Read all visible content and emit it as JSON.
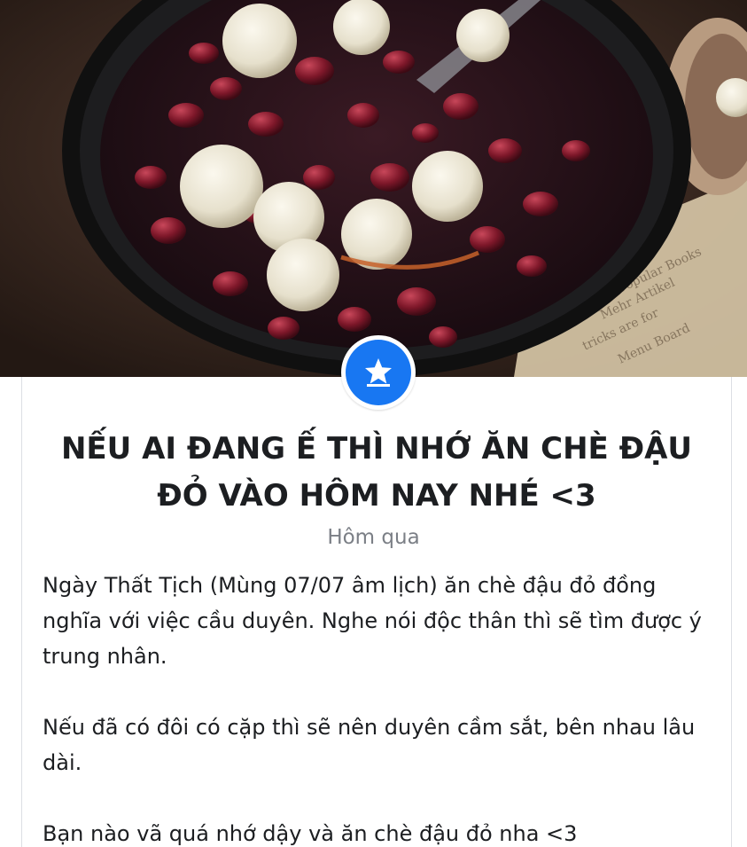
{
  "event": {
    "icon": "star-calendar-icon",
    "title": "NẾU AI ĐANG Ế THÌ NHỚ ĂN CHÈ ĐẬU ĐỎ VÀO HÔM NAY NHÉ <3",
    "date": "Hôm qua",
    "description": [
      "Ngày Thất Tịch (Mùng 07/07 âm lịch) ăn chè đậu đỏ đồng nghĩa với việc cầu duyên. Nghe nói độc thân thì sẽ tìm được ý trung nhân.",
      "Nếu đã có đôi có cặp thì sẽ nên duyên cầm sắt, bên nhau lâu dài.",
      "Bạn nào vã quá nhớ dậy và ăn chè đậu đỏ nha <3"
    ]
  },
  "colors": {
    "accent": "#1877f2",
    "text": "#1c1e21",
    "muted": "#7b7f86"
  }
}
